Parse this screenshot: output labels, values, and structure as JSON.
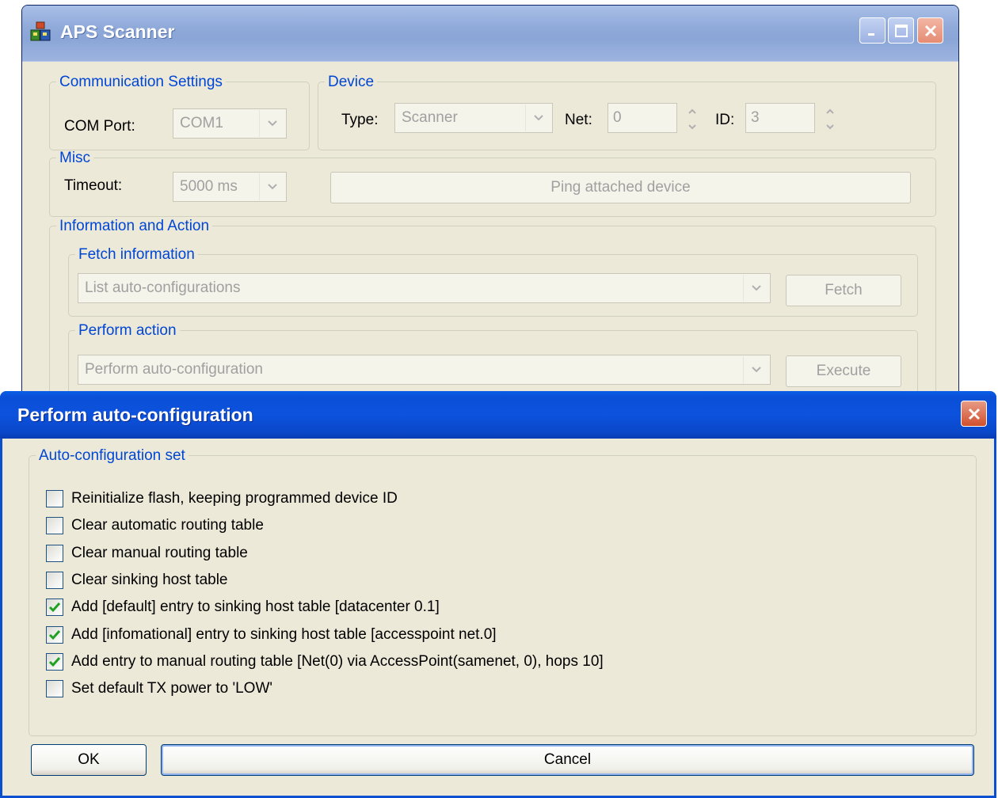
{
  "main_window": {
    "title": "APS Scanner",
    "communication": {
      "legend": "Communication Settings",
      "com_port_label": "COM Port:",
      "com_port_value": "COM1"
    },
    "device": {
      "legend": "Device",
      "type_label": "Type:",
      "type_value": "Scanner",
      "net_label": "Net:",
      "net_value": "0",
      "id_label": "ID:",
      "id_value": "3"
    },
    "misc": {
      "legend": "Misc",
      "timeout_label": "Timeout:",
      "timeout_value": "5000 ms",
      "ping_button": "Ping attached device"
    },
    "info_action": {
      "legend": "Information and Action",
      "fetch": {
        "legend": "Fetch information",
        "combo_value": "List auto-configurations",
        "button": "Fetch"
      },
      "perform": {
        "legend": "Perform action",
        "combo_value": "Perform auto-configuration",
        "button": "Execute"
      }
    }
  },
  "dialog": {
    "title": "Perform auto-configuration",
    "group_legend": "Auto-configuration set",
    "options": [
      {
        "label": "Reinitialize flash, keeping programmed device ID",
        "checked": false
      },
      {
        "label": "Clear automatic routing table",
        "checked": false
      },
      {
        "label": "Clear manual routing table",
        "checked": false
      },
      {
        "label": "Clear sinking host table",
        "checked": false
      },
      {
        "label": "Add [default] entry to sinking host table [datacenter 0.1]",
        "checked": true
      },
      {
        "label": "Add [infomational] entry to sinking host table [accesspoint net.0]",
        "checked": true
      },
      {
        "label": "Add entry to manual routing table [Net(0) via AccessPoint(samenet, 0), hops 10]",
        "checked": true
      },
      {
        "label": "Set default TX power to 'LOW'",
        "checked": false
      }
    ],
    "ok_button": "OK",
    "cancel_button": "Cancel"
  }
}
